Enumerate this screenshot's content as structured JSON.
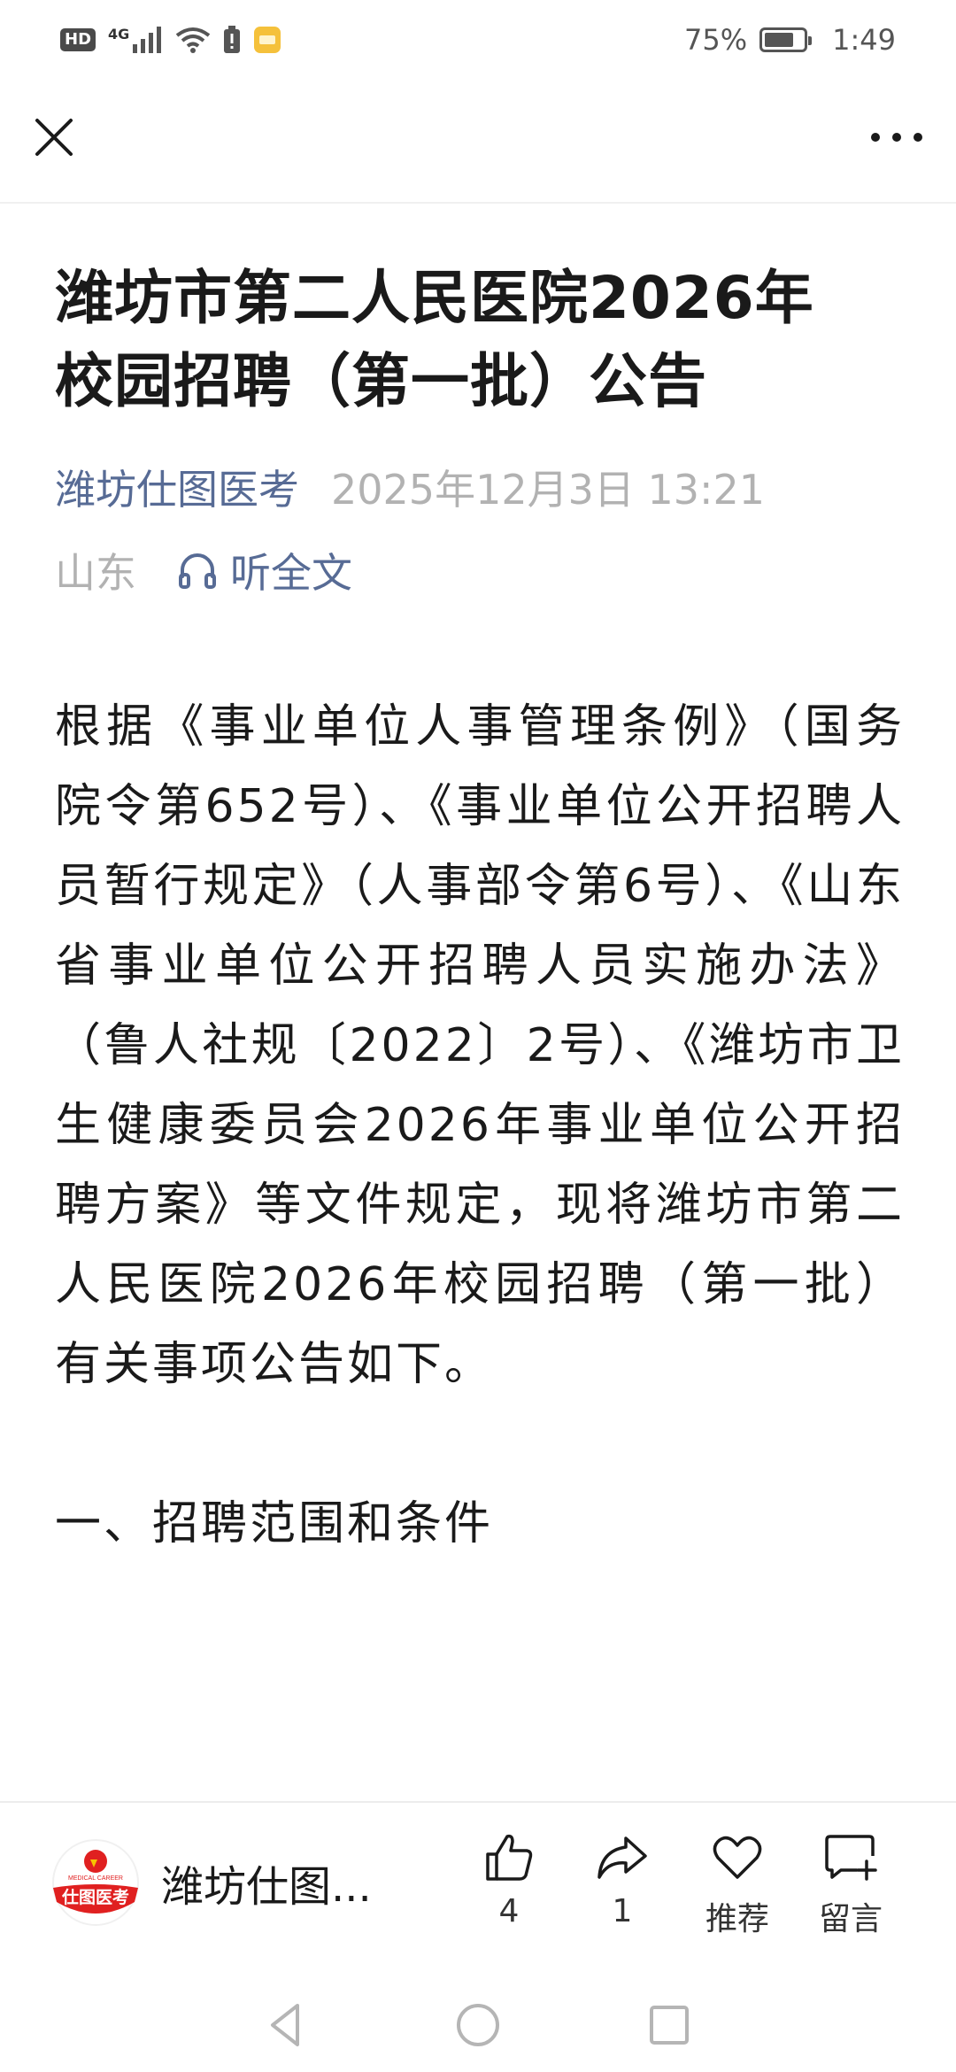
{
  "status_bar": {
    "hd_tag": "HD",
    "network": "4G",
    "battery_percent": "75%",
    "battery_level": 0.75,
    "time": "1:49"
  },
  "article": {
    "title_line1": "潍坊市第二人民医院2026年",
    "title_line2": "校园招聘（第一批）公告",
    "account_name": "潍坊仕图医考",
    "publish_time": "2025年12月3日 13:21",
    "region": "山东",
    "listen_label": "听全文",
    "body": "根据《事业单位人事管理条例》（国务院令第652号）、《事业单位公开招聘人员暂行规定》（人事部令第6号）、《山东省事业单位公开招聘人员实施办法》（鲁人社规〔2022〕2号）、《潍坊市卫生健康委员会2026年事业单位公开招聘方案》等文件规定，现将潍坊市第二人民医院2026年校园招聘（第一批）有关事项公告如下。",
    "section_1": "一、招聘范围和条件"
  },
  "bottom_bar": {
    "account_short": "潍坊仕图...",
    "logo_text": "仕图医考",
    "logo_subtext": "MEDICAL CAREER",
    "like_count": "4",
    "share_count": "1",
    "recommend_label": "推荐",
    "comment_label": "留言"
  },
  "colors": {
    "link_blue": "#576b95",
    "meta_gray": "#b2b2b2",
    "logo_red": "#e02020"
  }
}
